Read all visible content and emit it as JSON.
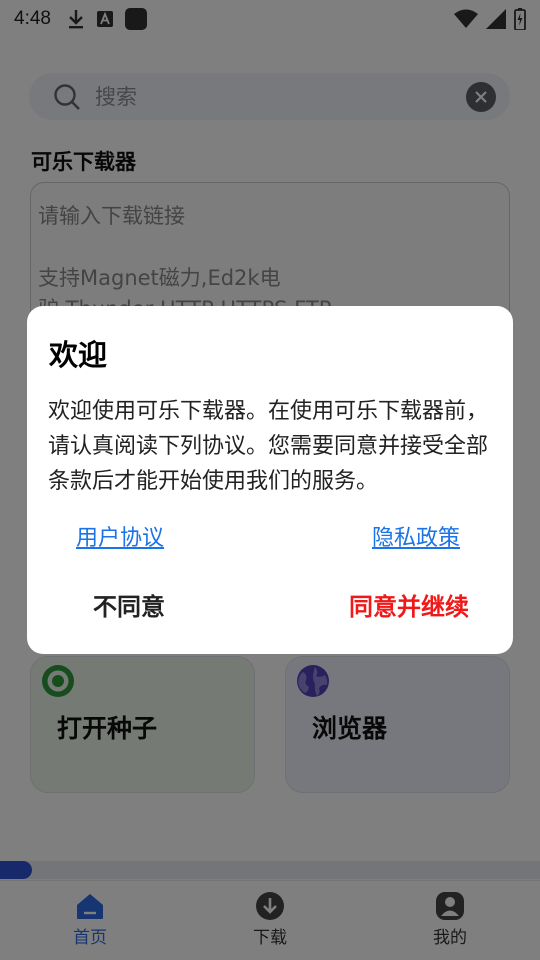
{
  "status_bar": {
    "time": "4:48",
    "left_icons": [
      "download-icon",
      "a-app-icon",
      "app-square-icon"
    ],
    "right_icons": [
      "wifi-icon",
      "signal-icon",
      "battery-icon"
    ]
  },
  "search": {
    "placeholder": "搜索",
    "icon": "search-icon",
    "clear_icon": "clear-icon"
  },
  "main": {
    "section_title": "可乐下载器",
    "link_input_placeholder": "请输入下载链接\n\n支持Magnet磁力,Ed2k电\n驴,Thunder,HTTP,HTTPS,FTP"
  },
  "cards": [
    {
      "label": "打开种子",
      "icon": "eye-icon",
      "color": "#2e9b3c"
    },
    {
      "label": "浏览器",
      "icon": "globe-icon",
      "color": "#5340b8"
    }
  ],
  "progress": {
    "fraction": 0.06
  },
  "bottom_nav": {
    "items": [
      {
        "label": "首页",
        "icon": "home-icon",
        "active": true
      },
      {
        "label": "下载",
        "icon": "download-circle-icon",
        "active": false
      },
      {
        "label": "我的",
        "icon": "profile-icon",
        "active": false
      }
    ]
  },
  "dialog": {
    "title": "欢迎",
    "message": "欢迎使用可乐下载器。在使用可乐下载器前，请认真阅读下列协议。您需要同意并接受全部条款后才能开始使用我们的服务。",
    "user_agreement_link": "用户协议",
    "privacy_policy_link": "隐私政策",
    "disagree_button": "不同意",
    "agree_button": "同意并继续"
  },
  "colors": {
    "accent": "#2f6ae6",
    "link": "#1a73e8",
    "agree": "#f01818",
    "overlay": "rgba(0,0,0,0.5)"
  }
}
